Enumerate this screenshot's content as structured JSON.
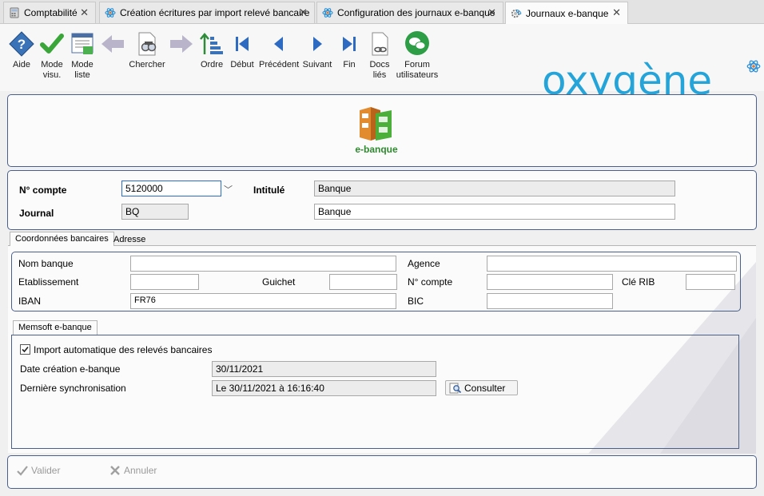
{
  "tabs": [
    {
      "label": "Comptabilité",
      "icon": "calculator-icon"
    },
    {
      "label": "Création écritures par import relevé bancaire",
      "icon": "atom-icon"
    },
    {
      "label": "Configuration des journaux e-banque",
      "icon": "atom-icon"
    },
    {
      "label": "Journaux e-banque",
      "icon": "gear-atom-icon",
      "active": true
    }
  ],
  "toolbar": {
    "aide": "Aide",
    "mode_visu": "Mode\nvisu.",
    "mode_liste": "Mode\nliste",
    "chercher": "Chercher",
    "ordre": "Ordre",
    "debut": "Début",
    "precedent": "Précédent",
    "suivant": "Suivant",
    "fin": "Fin",
    "docs_lies": "Docs\nliés",
    "forum": "Forum\nutilisateurs"
  },
  "brand": {
    "logo_text": "oxygène",
    "ebanque_label": "e-banque",
    "accent": "#25a4d9"
  },
  "account": {
    "n_compte_label": "N° compte",
    "n_compte_value": "5120000",
    "intitule_label": "Intitulé",
    "intitule_value": "Banque",
    "journal_label": "Journal",
    "journal_value": "BQ",
    "journal_name_value": "Banque"
  },
  "inner_tabs": {
    "coordonnees": "Coordonnées bancaires",
    "adresse": "Adresse"
  },
  "bank": {
    "nom_banque_label": "Nom banque",
    "nom_banque_value": "",
    "agence_label": "Agence",
    "agence_value": "",
    "etablissement_label": "Etablissement",
    "etablissement_value": "",
    "guichet_label": "Guichet",
    "guichet_value": "",
    "n_compte_label": "N° compte",
    "n_compte_value": "",
    "cle_rib_label": "Clé RIB",
    "cle_rib_value": "",
    "iban_label": "IBAN",
    "iban_value": "FR76",
    "bic_label": "BIC",
    "bic_value": ""
  },
  "memsoft": {
    "tab_label": "Memsoft e-banque",
    "import_auto_label": "Import automatique des relevés bancaires",
    "import_auto_checked": true,
    "date_creation_label": "Date création e-banque",
    "date_creation_value": "30/11/2021",
    "derniere_sync_label": "Dernière synchronisation",
    "derniere_sync_value": "Le 30/11/2021 à 16:16:40",
    "consulter_label": "Consulter"
  },
  "actions": {
    "valider": "Valider",
    "annuler": "Annuler"
  }
}
